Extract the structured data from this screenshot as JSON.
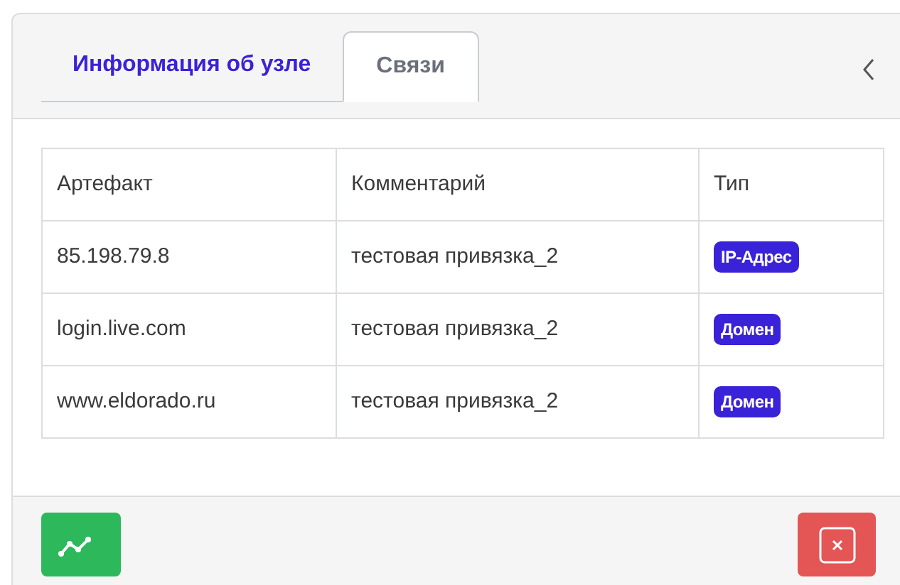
{
  "tabs": [
    {
      "label": "Информация об узле",
      "selected": false
    },
    {
      "label": "Связи",
      "selected": true
    }
  ],
  "table": {
    "columns": [
      "Артефакт",
      "Комментарий",
      "Тип"
    ],
    "rows": [
      {
        "artifact": "85.198.79.8",
        "comment": "тестовая привязка_2",
        "type": "IP-Адрес"
      },
      {
        "artifact": "login.live.com",
        "comment": "тестовая привязка_2",
        "type": "Домен"
      },
      {
        "artifact": "www.eldorado.ru",
        "comment": "тестовая привязка_2",
        "type": "Домен"
      }
    ]
  }
}
